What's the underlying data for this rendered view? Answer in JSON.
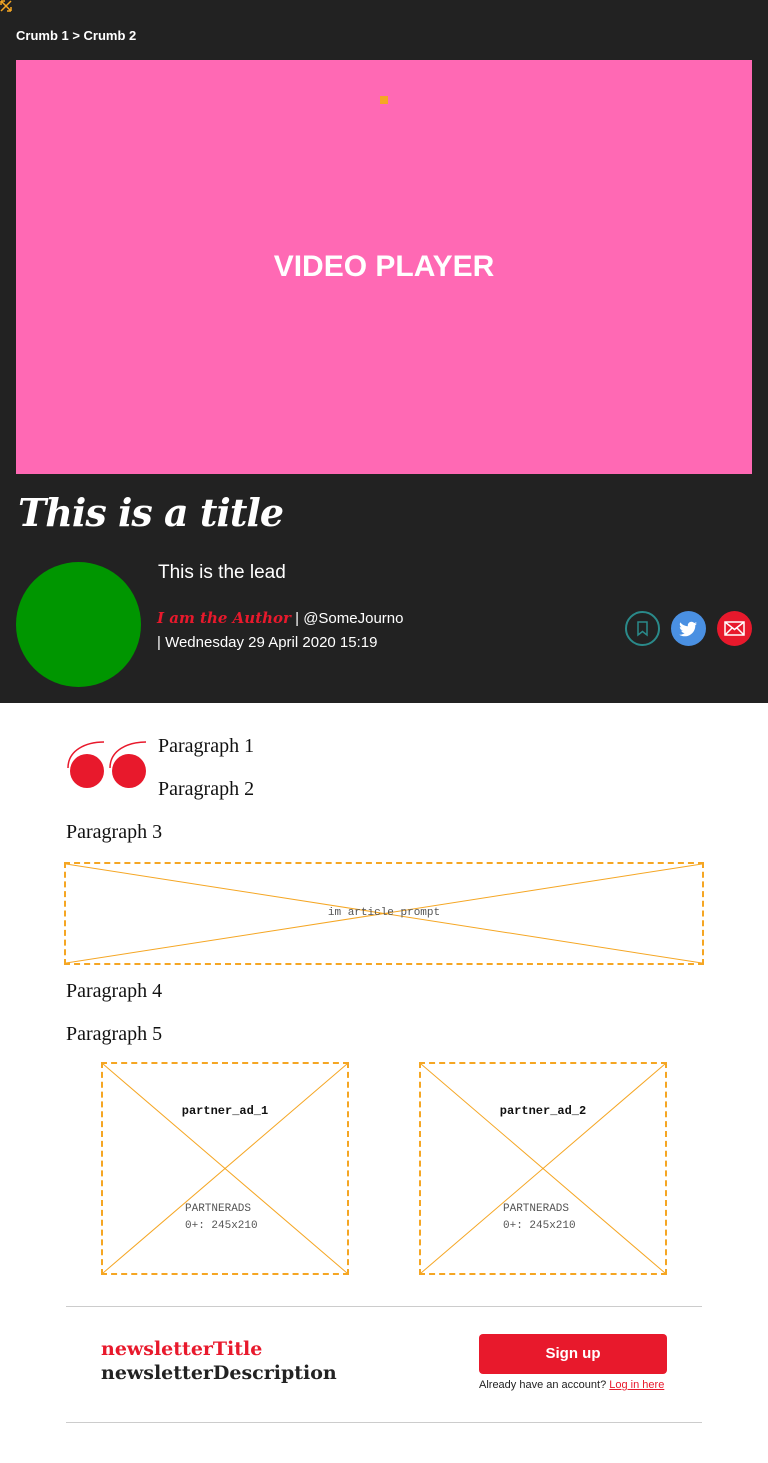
{
  "breadcrumb": {
    "text": "Crumb 1 > Crumb 2"
  },
  "video": {
    "label": "VIDEO PLAYER",
    "background": "#ff69b4"
  },
  "article": {
    "title": "This is a title",
    "lead": "This is the lead",
    "author": "I am the Author",
    "handle": "@SomeJourno",
    "date": "Wednesday 29 April 2020 15:19",
    "avatar_color": "#009600"
  },
  "share": {
    "icons": [
      "bookmark-icon",
      "twitter-icon",
      "mail-icon"
    ]
  },
  "body": {
    "paragraphs": [
      "Paragraph 1",
      "Paragraph 2",
      "Paragraph 3",
      "Paragraph 4",
      "Paragraph 5"
    ]
  },
  "ads": {
    "prompt_label": "im article prompt",
    "partners": [
      {
        "name": "partner_ad_1",
        "line1": "PARTNERADS",
        "line2": "0+: 245x210"
      },
      {
        "name": "partner_ad_2",
        "line1": "PARTNERADS",
        "line2": "0+: 245x210"
      }
    ]
  },
  "newsletter": {
    "title": "newsletterTitle",
    "description": "newsletterDescription",
    "signup_label": "Sign up",
    "account_text": "Already have an account?",
    "login_label": "Log in here"
  },
  "colors": {
    "accent": "#e8192c",
    "header_bg": "#222222",
    "ad_border": "#f5a623"
  }
}
